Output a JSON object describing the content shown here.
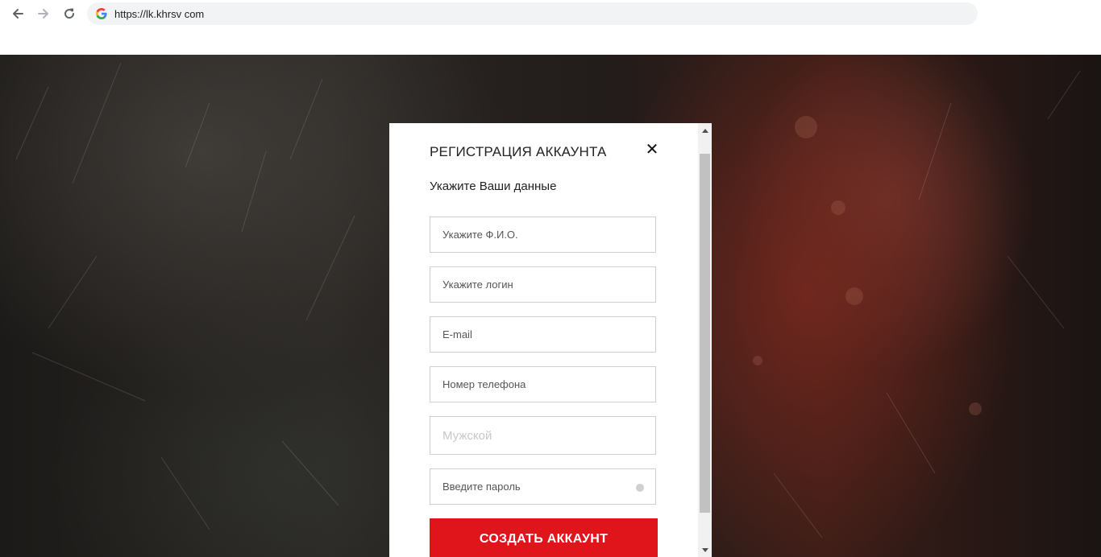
{
  "browser": {
    "url": "https://lk.khrsv com",
    "back_icon": "arrow-left-icon",
    "forward_icon": "arrow-right-icon",
    "reload_icon": "reload-icon",
    "site_icon": "google-g-icon"
  },
  "modal": {
    "title": "РЕГИСТРАЦИЯ АККАУНТА",
    "close_icon": "close-icon",
    "subtitle": "Укажите Ваши данные",
    "fields": {
      "full_name_placeholder": "Укажите Ф.И.О.",
      "login_placeholder": "Укажите логин",
      "email_placeholder": "E-mail",
      "phone_placeholder": "Номер телефона",
      "gender_value": "Мужской",
      "password_placeholder": "Введите пароль"
    },
    "submit_label": "СОЗДАТЬ АККАУНТ"
  },
  "colors": {
    "accent": "#e0141b",
    "omnibox_bg": "#f1f3f4"
  }
}
